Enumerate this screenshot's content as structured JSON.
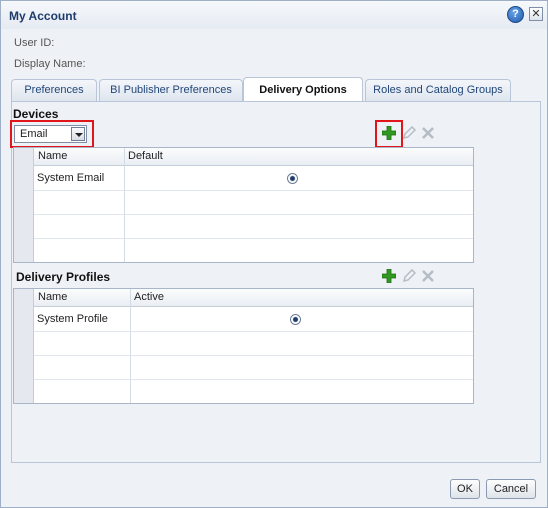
{
  "dialog": {
    "title": "My Account",
    "help_icon": "help-icon",
    "close_icon": "close-icon",
    "close_glyph": "✕",
    "help_glyph": "?"
  },
  "fields": {
    "user_id_label": "User ID:",
    "display_name_label": "Display Name:"
  },
  "tabs": [
    {
      "label": "Preferences",
      "active": false
    },
    {
      "label": "BI Publisher Preferences",
      "active": false
    },
    {
      "label": "Delivery Options",
      "active": true
    },
    {
      "label": "Roles and Catalog Groups",
      "active": false
    }
  ],
  "devices": {
    "title": "Devices",
    "select_value": "Email",
    "columns": [
      "Name",
      "Default"
    ],
    "rows": [
      {
        "name": "System Email",
        "default": true
      }
    ],
    "tools": [
      "add-icon",
      "edit-icon",
      "delete-icon"
    ]
  },
  "profiles": {
    "title": "Delivery Profiles",
    "columns": [
      "Name",
      "Active"
    ],
    "rows": [
      {
        "name": "System Profile",
        "active": true
      }
    ],
    "tools": [
      "add-icon",
      "edit-icon",
      "delete-icon"
    ]
  },
  "buttons": {
    "ok": "OK",
    "cancel": "Cancel"
  },
  "colors": {
    "highlight": "#e0161b",
    "title": "#1d3b6b",
    "add_green": "#2f9a1f"
  }
}
